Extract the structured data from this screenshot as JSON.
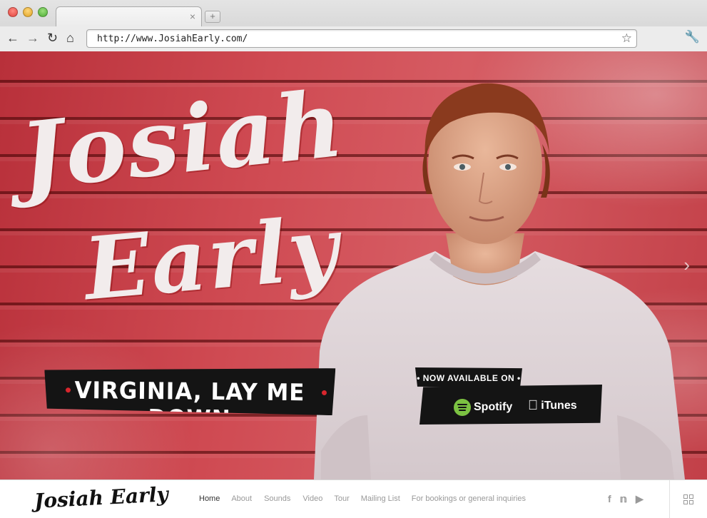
{
  "browser": {
    "url": "http://www.JosiahEarly.com/",
    "tab_close": "×",
    "new_tab": "+",
    "icons": {
      "back": "arrow-left-icon",
      "forward": "arrow-right-icon",
      "reload": "reload-icon",
      "home": "home-icon",
      "bookmark": "star-icon",
      "settings": "wrench-icon"
    }
  },
  "hero": {
    "title_first": "Josiah",
    "title_last": "Early",
    "album_banner": "VIRGINIA, LAY ME DOWN",
    "available_label": "• NOW AVAILABLE ON •",
    "services": [
      "Spotify",
      "iTunes"
    ]
  },
  "site_nav": {
    "logo": "Josiah Early",
    "items": [
      "Home",
      "About",
      "Sounds",
      "Video",
      "Tour",
      "Mailing List",
      "For bookings or general inquiries"
    ],
    "active": "Home",
    "social": [
      "facebook-icon",
      "twitter-icon",
      "youtube-icon"
    ],
    "menu_icon": "grid-icon"
  },
  "colors": {
    "barn_red": "#c4404a",
    "banner_black": "#141414",
    "banner_dot": "#d8262d",
    "spotify_green": "#7cc242"
  }
}
